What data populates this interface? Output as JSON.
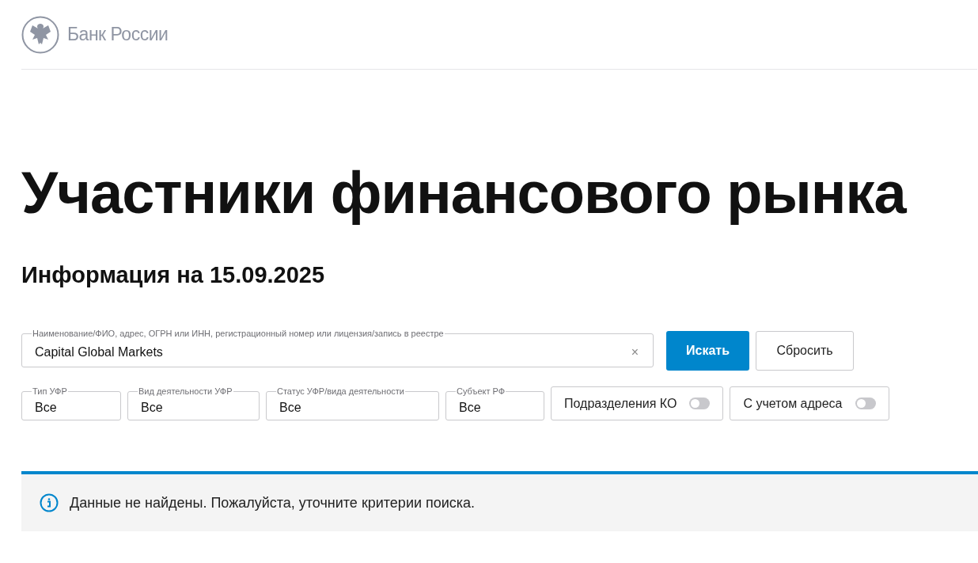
{
  "logo": {
    "text": "Банк России"
  },
  "title": "Участники финансового рынка",
  "subtitle": "Информация на 15.09.2025",
  "search": {
    "label": "Наименование/ФИО, адрес, ОГРН или ИНН, регистрационный номер или лицензия/запись в реестре",
    "value": "Capital Global Markets",
    "clear": "×"
  },
  "buttons": [
    {
      "label": "Искать",
      "kind": "primary"
    },
    {
      "label": "Сбросить",
      "kind": "secondary"
    }
  ],
  "filters": [
    {
      "kind": "select",
      "label": "Тип УФР",
      "value": "Все"
    },
    {
      "kind": "select",
      "label": "Вид деятельности УФР",
      "value": "Все"
    },
    {
      "kind": "select",
      "label": "Статус УФР/вида деятельности",
      "value": "Все"
    },
    {
      "kind": "select",
      "label": "Субъект РФ",
      "value": "Все"
    },
    {
      "kind": "toggle",
      "label": "Подразделения КО",
      "on": false
    },
    {
      "kind": "toggle",
      "label": "С учетом адреса",
      "on": false
    }
  ],
  "notice": {
    "text": "Данные не найдены. Пожалуйста, уточните критерии поиска."
  }
}
